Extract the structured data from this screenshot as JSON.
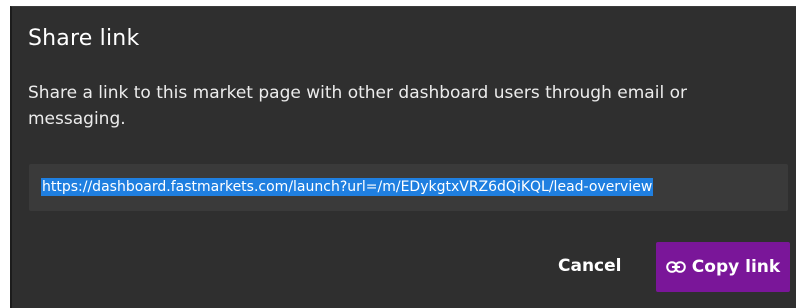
{
  "dialog": {
    "title": "Share link",
    "description": "Share a link to this market page with other dashboard users through email or messaging.",
    "share_url": "https://dashboard.fastmarkets.com/launch?url=/m/EDykgtxVRZ6dQiKQL/lead-overview",
    "cancel_label": "Cancel",
    "copy_label": "Copy link",
    "copy_icon": "link-icon"
  },
  "colors": {
    "dialog_background": "#2f2f2f",
    "url_box_background": "#3a3a3a",
    "selection_highlight": "#1f7fe0",
    "primary_button": "#7a1699",
    "text": "#ffffff"
  }
}
